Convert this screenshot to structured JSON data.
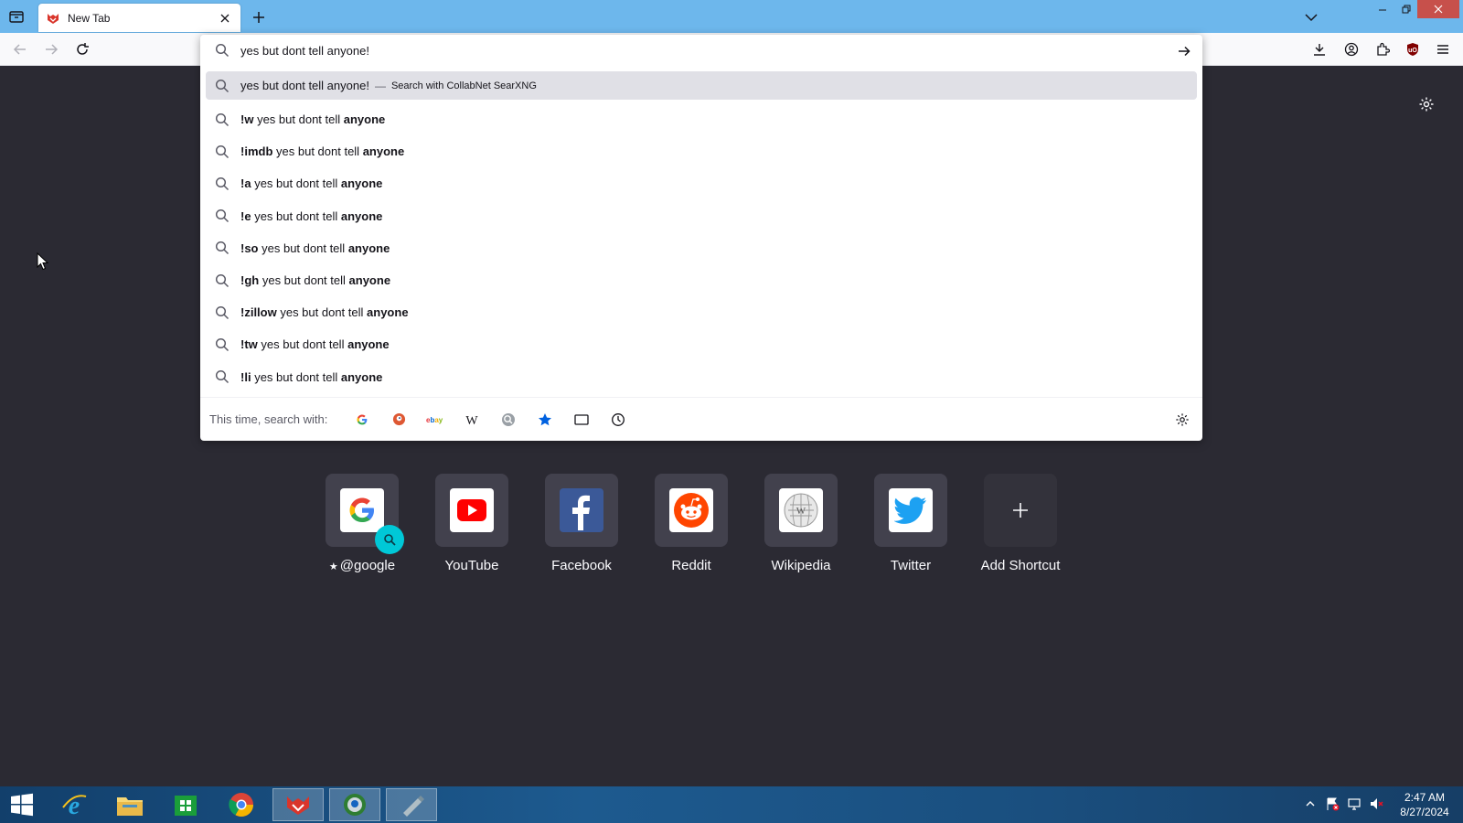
{
  "tabs": [
    {
      "title": "New Tab",
      "active": true
    }
  ],
  "urlbar": {
    "value": "yes but dont tell anyone!",
    "heuristic": {
      "query": "yes but dont tell anyone!",
      "separator": "—",
      "action": "Search with CollabNet SearXNG"
    },
    "suggestions": [
      {
        "bang": "!w",
        "text": "yes but dont tell",
        "bold": "anyone"
      },
      {
        "bang": "!imdb",
        "text": "yes but dont tell",
        "bold": "anyone"
      },
      {
        "bang": "!a",
        "text": "yes but dont tell",
        "bold": "anyone"
      },
      {
        "bang": "!e",
        "text": "yes but dont tell",
        "bold": "anyone"
      },
      {
        "bang": "!so",
        "text": "yes but dont tell",
        "bold": "anyone"
      },
      {
        "bang": "!gh",
        "text": "yes but dont tell",
        "bold": "anyone"
      },
      {
        "bang": "!zillow",
        "text": "yes but dont tell",
        "bold": "anyone"
      },
      {
        "bang": "!tw",
        "text": "yes but dont tell",
        "bold": "anyone"
      },
      {
        "bang": "!li",
        "text": "yes but dont tell",
        "bold": "anyone"
      }
    ],
    "oneoff_label": "This time, search with:",
    "oneoff_engines": [
      "google-icon",
      "duckduckgo-icon",
      "ebay-icon",
      "wikipedia-icon",
      "searxng-icon",
      "bookmarks-icon",
      "tabs-icon",
      "history-icon"
    ]
  },
  "shortcuts": [
    {
      "label": "@google",
      "icon": "google-icon",
      "pinned": true
    },
    {
      "label": "YouTube",
      "icon": "youtube-icon"
    },
    {
      "label": "Facebook",
      "icon": "facebook-icon"
    },
    {
      "label": "Reddit",
      "icon": "reddit-icon"
    },
    {
      "label": "Wikipedia",
      "icon": "wikipedia-icon"
    },
    {
      "label": "Twitter",
      "icon": "twitter-icon"
    },
    {
      "label": "Add Shortcut",
      "icon": "plus-icon"
    }
  ],
  "taskbar": {
    "apps": [
      "start-icon",
      "internet-explorer-icon",
      "file-explorer-icon",
      "store-icon",
      "chrome-icon",
      "librewolf-icon",
      "app-icon",
      "usb-tool-icon"
    ],
    "time": "2:47 AM",
    "date": "8/27/2024"
  },
  "colors": {
    "page_bg": "#2b2a33",
    "tabbar": "#6db7ec",
    "tile_bg": "#42414d",
    "close_red": "#c7504b"
  }
}
